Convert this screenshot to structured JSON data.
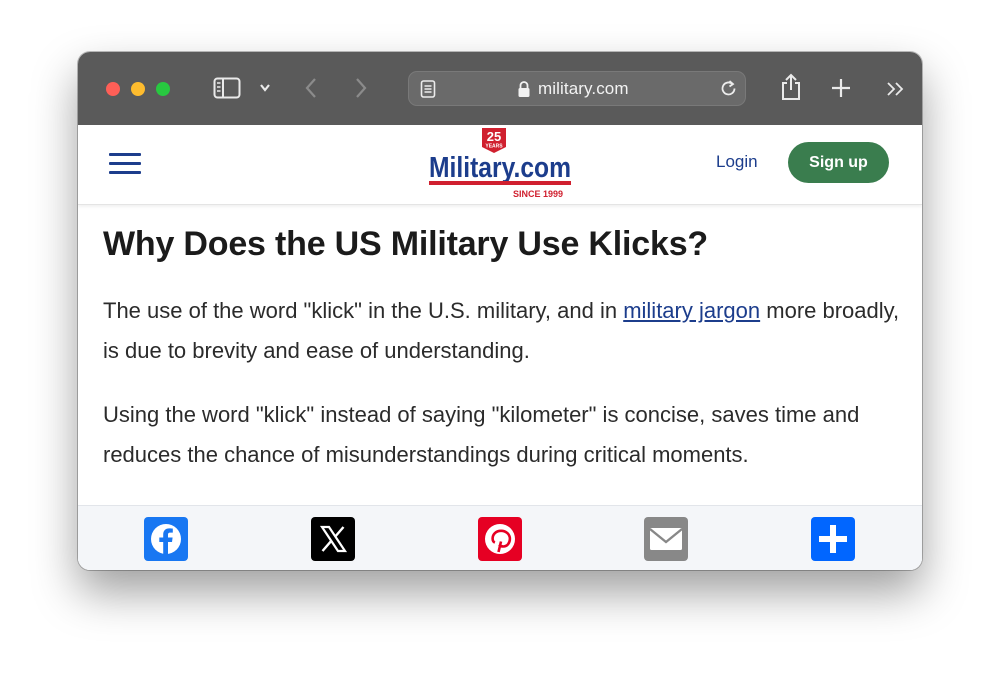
{
  "browser": {
    "url": "military.com",
    "colors": {
      "toolbar": "#5a5a5a",
      "address_bar": "#6a6a6a"
    },
    "icons": [
      "sidebar-icon",
      "chevron-down-icon",
      "back-icon",
      "forward-icon",
      "reader-icon",
      "lock-icon",
      "reload-icon",
      "share-icon",
      "new-tab-icon",
      "more-icon"
    ]
  },
  "site": {
    "logo": {
      "badge_number": "25",
      "badge_word": "YEARS",
      "name": "Military.com",
      "tagline": "SINCE 1999"
    },
    "login_label": "Login",
    "signup_label": "Sign up",
    "colors": {
      "brand_blue": "#1c3d8c",
      "brand_red": "#d0202f",
      "signup_green": "#3a7d4e"
    }
  },
  "article": {
    "title": "Why Does the US Military Use Klicks?",
    "para1_before": "The use of the word \"klick\" in the U.S. military, and in ",
    "para1_link": "military jargon",
    "para1_after": " more broadly, is due to brevity and ease of understanding.",
    "para2": "Using the word \"klick\" instead of saying \"kilometer\" is concise, saves time and reduces the chance of misunderstandings during critical moments."
  },
  "share": {
    "buttons": [
      {
        "name": "facebook",
        "icon": "facebook-icon",
        "color": "#1877f2"
      },
      {
        "name": "x",
        "icon": "x-icon",
        "color": "#000000"
      },
      {
        "name": "pinterest",
        "icon": "pinterest-icon",
        "color": "#e60023"
      },
      {
        "name": "email",
        "icon": "mail-icon",
        "color": "#888888"
      },
      {
        "name": "more",
        "icon": "plus-icon",
        "color": "#0166ff"
      }
    ]
  }
}
